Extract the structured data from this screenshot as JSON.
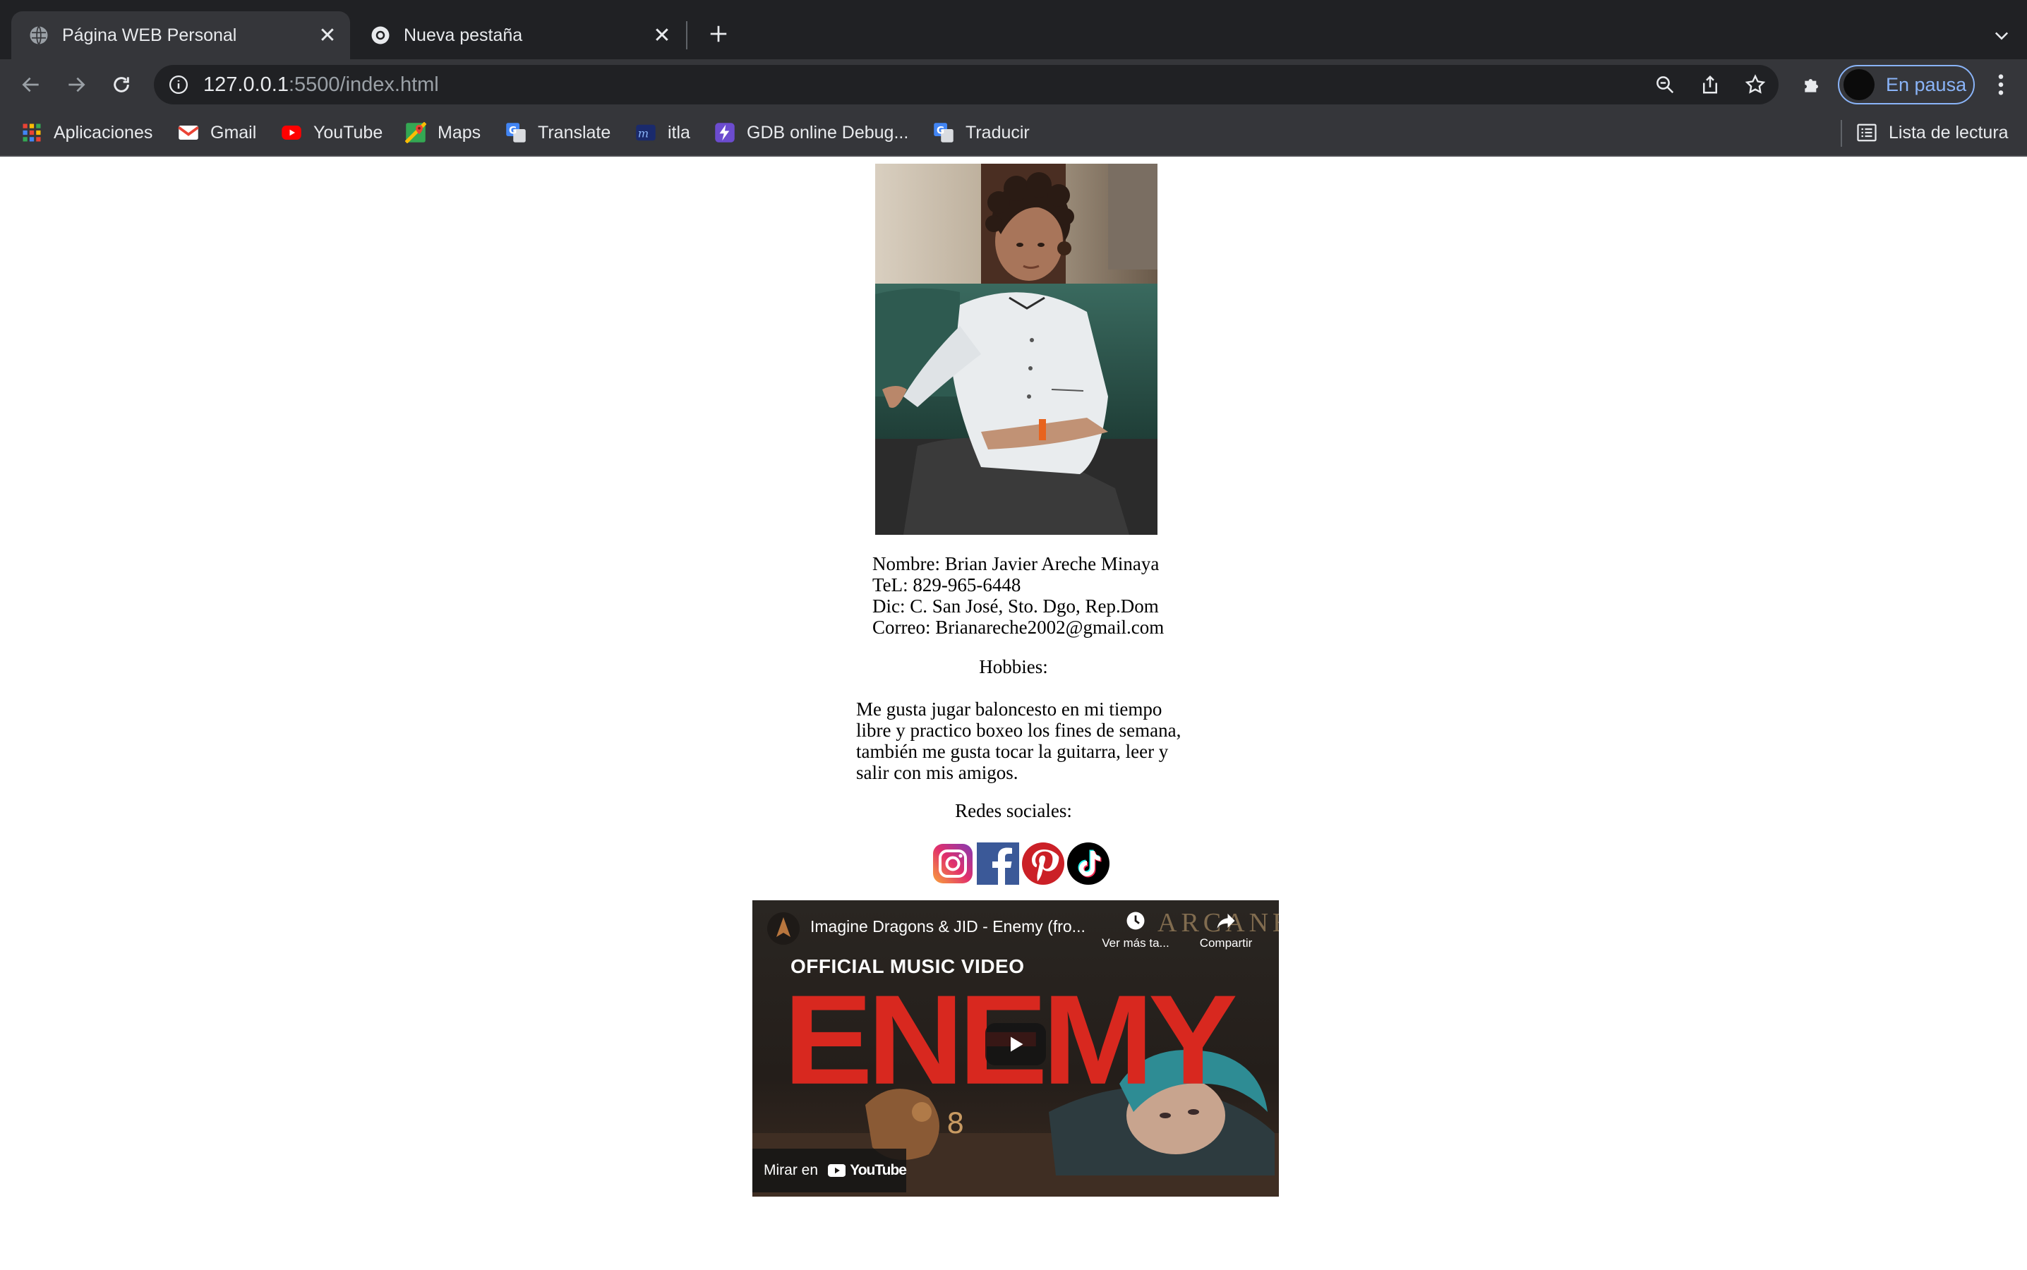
{
  "tabs": [
    {
      "title": "Página WEB Personal",
      "active": true
    },
    {
      "title": "Nueva pestaña",
      "active": false
    }
  ],
  "toolbar": {
    "url_host": "127.0.0.1",
    "url_path": ":5500/index.html",
    "profile_label": "En pausa"
  },
  "bookmarks": [
    {
      "label": "Aplicaciones",
      "icon": "apps-grid-icon"
    },
    {
      "label": "Gmail",
      "icon": "gmail-icon"
    },
    {
      "label": "YouTube",
      "icon": "youtube-icon"
    },
    {
      "label": "Maps",
      "icon": "maps-icon"
    },
    {
      "label": "Translate",
      "icon": "translate-icon"
    },
    {
      "label": "itla",
      "icon": "itla-icon"
    },
    {
      "label": "GDB online Debug...",
      "icon": "gdb-icon"
    },
    {
      "label": "Traducir",
      "icon": "translate-icon"
    }
  ],
  "reading_list": "Lista de lectura",
  "profile": {
    "name_line": "Nombre: Brian Javier Areche Minaya",
    "phone_line": "TeL: 829-965-6448",
    "address_line": "Dic: C. San José, Sto. Dgo, Rep.Dom",
    "email_line": "Correo: Brianareche2002@gmail.com"
  },
  "hobbies": {
    "title": "Hobbies:",
    "text": "Me gusta jugar baloncesto en mi tiempo libre y practico boxeo los fines de semana, también me gusta tocar la guitarra, leer y salir con mis amigos."
  },
  "social": {
    "title": "Redes sociales:",
    "icons": [
      "instagram-icon",
      "facebook-icon",
      "pinterest-icon",
      "tiktok-icon"
    ]
  },
  "video": {
    "title": "Imagine Dragons & JID - Enemy (fro...",
    "watch_later": "Ver más ta...",
    "share": "Compartir",
    "overlay_top": "OFFICIAL MUSIC VIDEO",
    "overlay_big": "ENEMY",
    "brand": "ARCANE",
    "watch_on": "Mirar en",
    "youtube": "YouTube"
  },
  "colors": {
    "chrome_bg": "#202124",
    "toolbar_bg": "#35363a",
    "accent": "#8ab4f8",
    "enemy_red": "#d8281f"
  }
}
